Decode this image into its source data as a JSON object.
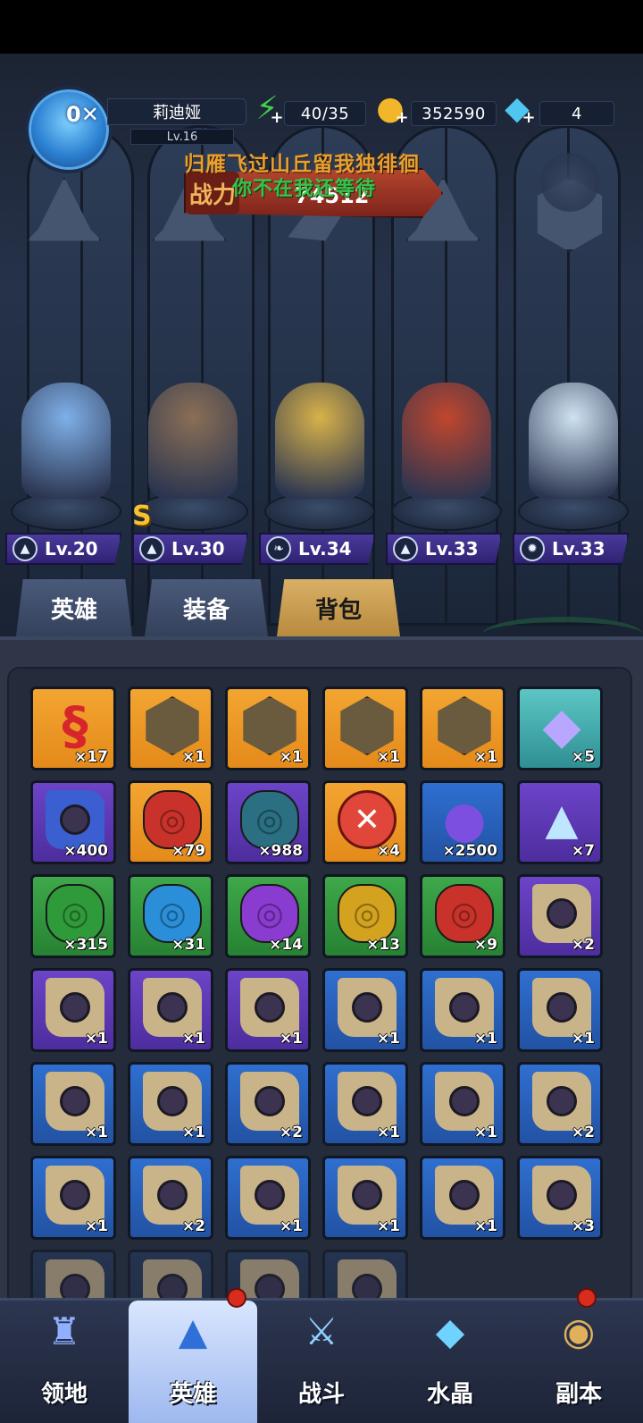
{
  "header": {
    "vip": "0",
    "player_name": "莉迪娅",
    "player_level": "Lv.16",
    "stamina": "40/35",
    "gold": "352590",
    "diamonds": "4",
    "power_label": "战力",
    "power_value": "74512",
    "lyric_line1": "归雁飞过山丘留我独徘徊",
    "lyric_line2": "你不在我还等待"
  },
  "heroes": [
    {
      "level": "Lv.20",
      "class_icon": "hat-icon",
      "color": "#7fb0e8"
    },
    {
      "level": "Lv.30",
      "class_icon": "hat-icon",
      "color": "#8a6f55",
      "badge": "S"
    },
    {
      "level": "Lv.34",
      "class_icon": "wing-icon",
      "color": "#d8b24a"
    },
    {
      "level": "Lv.33",
      "class_icon": "hat-icon",
      "color": "#c0462e"
    },
    {
      "level": "Lv.33",
      "class_icon": "beast-icon",
      "color": "#cfe3f2"
    }
  ],
  "tabs": [
    {
      "label": "英雄",
      "active": false
    },
    {
      "label": "装备",
      "active": false
    },
    {
      "label": "背包",
      "active": true
    }
  ],
  "inventory": [
    {
      "qty": "×17",
      "frame": "orange",
      "icon": "red-dragon-icon"
    },
    {
      "qty": "×1",
      "frame": "orange",
      "icon": "hero-shard-icon"
    },
    {
      "qty": "×1",
      "frame": "orange",
      "icon": "hero-shard-icon"
    },
    {
      "qty": "×1",
      "frame": "orange",
      "icon": "hero-shard-icon"
    },
    {
      "qty": "×1",
      "frame": "orange",
      "icon": "hero-shard-icon"
    },
    {
      "qty": "×5",
      "frame": "teal",
      "icon": "crystal-icon"
    },
    {
      "qty": "×400",
      "frame": "purple",
      "icon": "blue-scroll-icon"
    },
    {
      "qty": "×79",
      "frame": "orange",
      "icon": "red-rune-stone-icon"
    },
    {
      "qty": "×988",
      "frame": "purple",
      "icon": "teal-rune-stone-icon"
    },
    {
      "qty": "×4",
      "frame": "orange",
      "icon": "red-seal-icon"
    },
    {
      "qty": "×2500",
      "frame": "blue",
      "icon": "potion-icon"
    },
    {
      "qty": "×7",
      "frame": "purple",
      "icon": "ice-shard-icon"
    },
    {
      "qty": "×315",
      "frame": "green",
      "icon": "green-rune-stone-icon"
    },
    {
      "qty": "×31",
      "frame": "green",
      "icon": "blue-rune-stone-icon"
    },
    {
      "qty": "×14",
      "frame": "green",
      "icon": "purple-rune-stone-icon"
    },
    {
      "qty": "×13",
      "frame": "green",
      "icon": "gold-rune-stone-icon"
    },
    {
      "qty": "×9",
      "frame": "green",
      "icon": "red-rune-stone-icon"
    },
    {
      "qty": "×2",
      "frame": "purple",
      "icon": "skill-scroll-icon"
    },
    {
      "qty": "×1",
      "frame": "purple",
      "icon": "skill-scroll-icon"
    },
    {
      "qty": "×1",
      "frame": "purple",
      "icon": "skill-scroll-icon"
    },
    {
      "qty": "×1",
      "frame": "purple",
      "icon": "skill-scroll-icon"
    },
    {
      "qty": "×1",
      "frame": "blue",
      "icon": "skill-scroll-icon"
    },
    {
      "qty": "×1",
      "frame": "blue",
      "icon": "skill-scroll-icon"
    },
    {
      "qty": "×1",
      "frame": "blue",
      "icon": "skill-scroll-icon"
    },
    {
      "qty": "×1",
      "frame": "blue",
      "icon": "skill-scroll-icon"
    },
    {
      "qty": "×1",
      "frame": "blue",
      "icon": "skill-scroll-icon"
    },
    {
      "qty": "×2",
      "frame": "blue",
      "icon": "skill-scroll-icon"
    },
    {
      "qty": "×1",
      "frame": "blue",
      "icon": "skill-scroll-icon"
    },
    {
      "qty": "×1",
      "frame": "blue",
      "icon": "skill-scroll-icon"
    },
    {
      "qty": "×2",
      "frame": "blue",
      "icon": "skill-scroll-icon"
    },
    {
      "qty": "×1",
      "frame": "blue",
      "icon": "skill-scroll-icon"
    },
    {
      "qty": "×2",
      "frame": "blue",
      "icon": "skill-scroll-icon"
    },
    {
      "qty": "×1",
      "frame": "blue",
      "icon": "skill-scroll-icon"
    },
    {
      "qty": "×1",
      "frame": "blue",
      "icon": "skill-scroll-icon"
    },
    {
      "qty": "×1",
      "frame": "blue",
      "icon": "skill-scroll-icon"
    },
    {
      "qty": "×3",
      "frame": "blue",
      "icon": "skill-scroll-icon"
    },
    {
      "qty": "",
      "frame": "dim",
      "icon": "skill-scroll-icon"
    },
    {
      "qty": "",
      "frame": "dim",
      "icon": "skill-scroll-icon"
    },
    {
      "qty": "",
      "frame": "dim",
      "icon": "skill-scroll-icon"
    },
    {
      "qty": "",
      "frame": "dim",
      "icon": "skill-scroll-icon"
    }
  ],
  "nav": [
    {
      "label": "领地",
      "icon": "castle-icon",
      "active": false
    },
    {
      "label": "英雄",
      "icon": "wizard-hat-icon",
      "active": true
    },
    {
      "label": "战斗",
      "icon": "battle-icon",
      "active": false
    },
    {
      "label": "水晶",
      "icon": "crystal-icon",
      "active": false
    },
    {
      "label": "副本",
      "icon": "portal-icon",
      "active": false
    }
  ]
}
